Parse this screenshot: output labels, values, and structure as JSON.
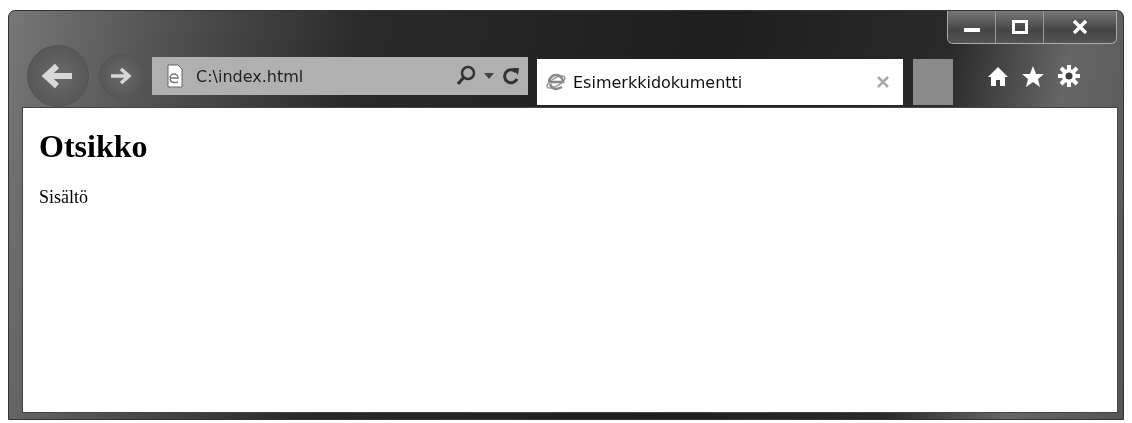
{
  "address_bar": {
    "value": "C:\\index.html"
  },
  "tabs": [
    {
      "title": "Esimerkkidokumentti",
      "selected": true
    }
  ],
  "page": {
    "heading": "Otsikko",
    "paragraph": "Sisältö"
  }
}
